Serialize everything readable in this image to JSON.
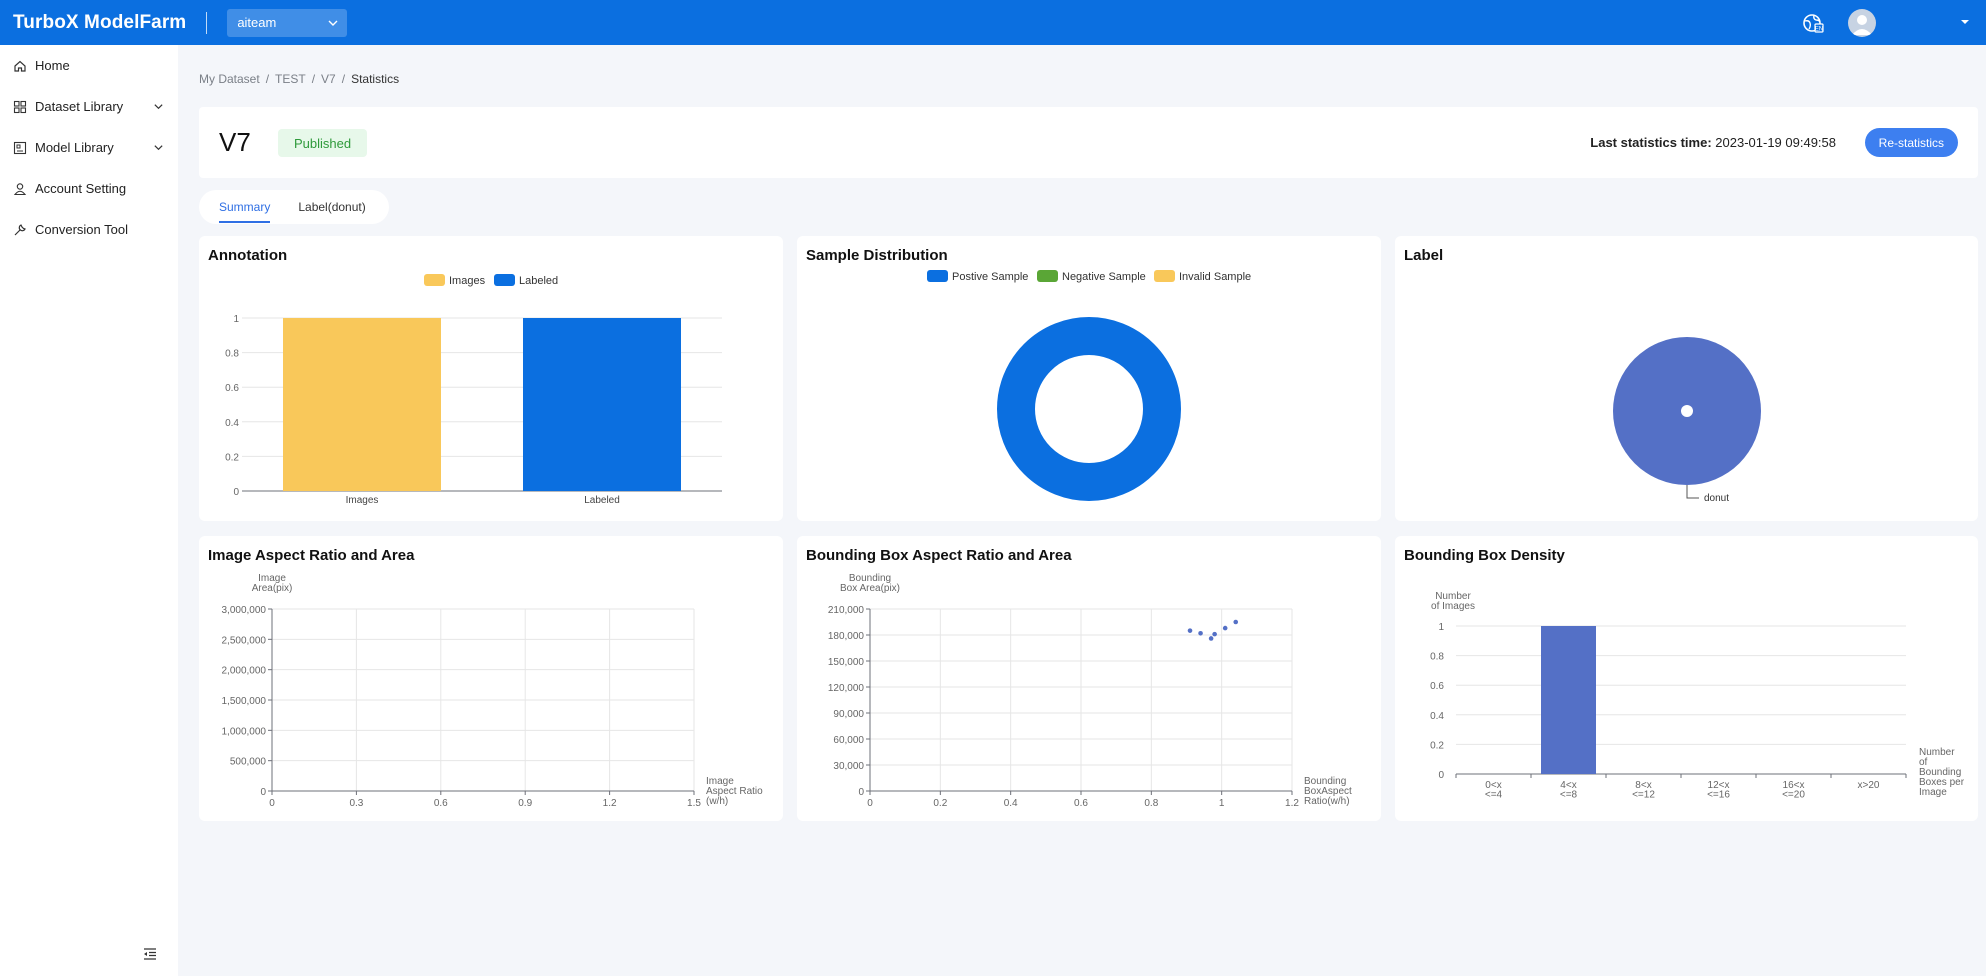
{
  "app": {
    "title": "TurboX ModelFarm",
    "team_selected": "aiteam"
  },
  "sidebar": {
    "items": [
      {
        "label": "Home",
        "icon": "home-icon"
      },
      {
        "label": "Dataset Library",
        "icon": "grid-icon",
        "expandable": true
      },
      {
        "label": "Model Library",
        "icon": "model-icon",
        "expandable": true
      },
      {
        "label": "Account Setting",
        "icon": "user-icon"
      },
      {
        "label": "Conversion Tool",
        "icon": "wrench-icon"
      }
    ]
  },
  "breadcrumb": [
    "My Dataset",
    "/",
    "TEST",
    "/",
    "V7",
    "/",
    "Statistics"
  ],
  "header": {
    "version": "V7",
    "status": "Published",
    "last_stats_label": "Last statistics time:",
    "last_stats_value": "2023-01-19 09:49:58",
    "restat_label": "Re-statistics"
  },
  "tabs": [
    {
      "label": "Summary",
      "active": true
    },
    {
      "label": "Label(donut)",
      "active": false
    }
  ],
  "cards": {
    "annotation": "Annotation",
    "sample": "Sample Distribution",
    "label": "Label",
    "image_ratio": "Image Aspect Ratio and Area",
    "bbox_ratio": "Bounding Box Aspect Ratio and Area",
    "bbox_density": "Bounding Box Density"
  },
  "colors": {
    "brand": "#0b6fe0",
    "yellow": "#f9c85a",
    "blue": "#0b6fe0",
    "green": "#5aa636",
    "purple_blue": "#5470c6"
  },
  "chart_data": [
    {
      "type": "bar",
      "title": "Annotation",
      "categories": [
        "Images",
        "Labeled"
      ],
      "values": [
        1,
        1
      ],
      "legend": [
        "Images",
        "Labeled"
      ],
      "colors": [
        "#f9c85a",
        "#0b6fe0"
      ],
      "ylim": [
        0,
        1
      ],
      "yticks": [
        "0",
        "0.2",
        "0.4",
        "0.6",
        "0.8",
        "1"
      ]
    },
    {
      "type": "pie",
      "title": "Sample Distribution",
      "legend": [
        "Postive Sample",
        "Negative Sample",
        "Invalid Sample"
      ],
      "colors": [
        "#0b6fe0",
        "#5aa636",
        "#f9c85a"
      ],
      "values": [
        1,
        0,
        0
      ],
      "donut": true
    },
    {
      "type": "pie",
      "title": "Label",
      "labels": [
        "donut"
      ],
      "values": [
        1
      ],
      "colors": [
        "#5470c6"
      ]
    },
    {
      "type": "scatter",
      "title": "Image Aspect Ratio and Area",
      "xlabel": [
        "Image",
        "Aspect Ratio",
        "(w/h)"
      ],
      "ylabel": [
        "Image",
        "Area(pix)"
      ],
      "xticks": [
        "0",
        "0.3",
        "0.6",
        "0.9",
        "1.2",
        "1.5"
      ],
      "yticks": [
        "0",
        "500,000",
        "1,000,000",
        "1,500,000",
        "2,000,000",
        "2,500,000",
        "3,000,000"
      ],
      "xlim": [
        0,
        1.5
      ],
      "ylim": [
        0,
        3000000
      ],
      "points": []
    },
    {
      "type": "scatter",
      "title": "Bounding Box Aspect Ratio and Area",
      "xlabel": [
        "Bounding",
        "BoxAspect",
        "Ratio(w/h)"
      ],
      "ylabel": [
        "Bounding",
        "Box Area(pix)"
      ],
      "xticks": [
        "0",
        "0.2",
        "0.4",
        "0.6",
        "0.8",
        "1",
        "1.2"
      ],
      "yticks": [
        "0",
        "30,000",
        "60,000",
        "90,000",
        "120,000",
        "150,000",
        "180,000",
        "210,000"
      ],
      "xlim": [
        0,
        1.2
      ],
      "ylim": [
        0,
        210000
      ],
      "points": [
        [
          0.91,
          185000
        ],
        [
          0.94,
          182000
        ],
        [
          0.97,
          176000
        ],
        [
          0.98,
          181000
        ],
        [
          1.01,
          188000
        ],
        [
          1.04,
          195000
        ]
      ]
    },
    {
      "type": "bar",
      "title": "Bounding Box Density",
      "categories": [
        [
          "0<x",
          "<=4"
        ],
        [
          "4<x",
          "<=8"
        ],
        [
          "8<x",
          "<=12"
        ],
        [
          "12<x",
          "<=16"
        ],
        [
          "16<x",
          "<=20"
        ],
        [
          "x>20"
        ]
      ],
      "values": [
        0,
        1,
        0,
        0,
        0,
        0
      ],
      "ylabel": [
        "Number",
        "of Images"
      ],
      "xlabel": [
        "Number",
        "of",
        "Bounding",
        "Boxes per",
        "Image"
      ],
      "yticks": [
        "0",
        "0.2",
        "0.4",
        "0.6",
        "0.8",
        "1"
      ],
      "ylim": [
        0,
        1
      ],
      "colors": [
        "#5470c6"
      ]
    }
  ]
}
